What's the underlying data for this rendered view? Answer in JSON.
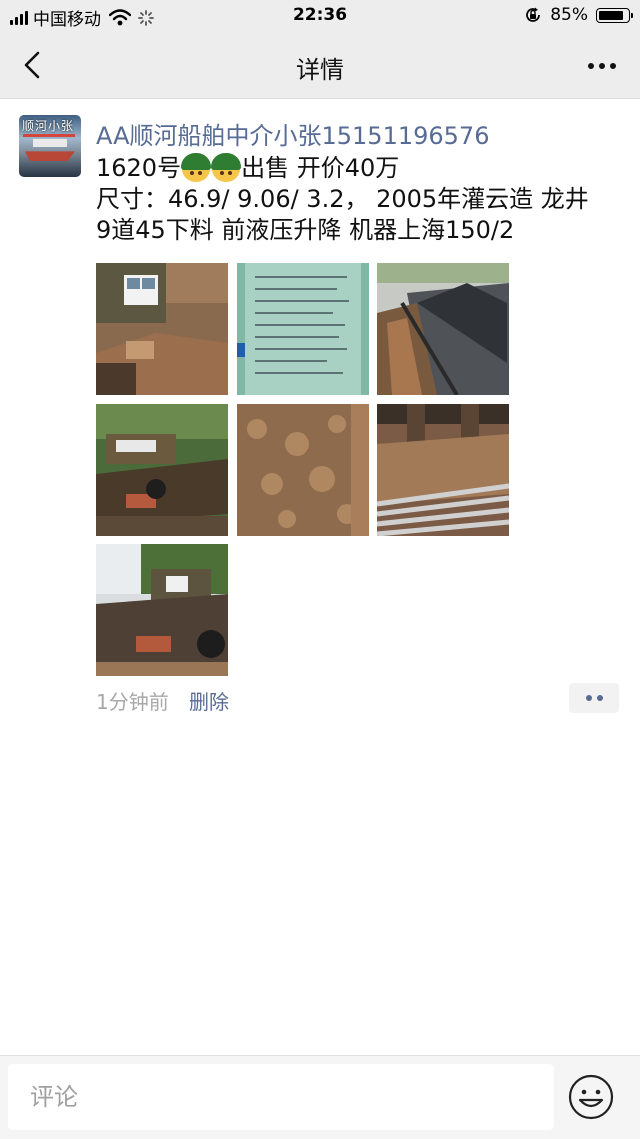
{
  "status_bar": {
    "carrier": "中国移动",
    "time": "22:36",
    "battery_text": "85%",
    "battery_level": 0.85
  },
  "nav": {
    "title": "详情"
  },
  "post": {
    "avatar_text": "顺河小张",
    "author": "AA顺河船舶中介小张15151196576",
    "line1_prefix": "1620号",
    "line1_suffix": "出售 开价40万",
    "line2": "尺寸：46.9/ 9.06/ 3.2， 2005年灌云造 龙井",
    "line3": "9道45下料 前液压升降 机器上海150/2",
    "emoji_name": "soldier-helmet-emoji",
    "photo_count": 7,
    "time": "1分钟前",
    "delete_label": "删除"
  },
  "comment_bar": {
    "placeholder": "评论"
  },
  "colors": {
    "link": "#576b95",
    "navbar_bg": "#ededed",
    "meta_gray": "#a8a8a8"
  }
}
